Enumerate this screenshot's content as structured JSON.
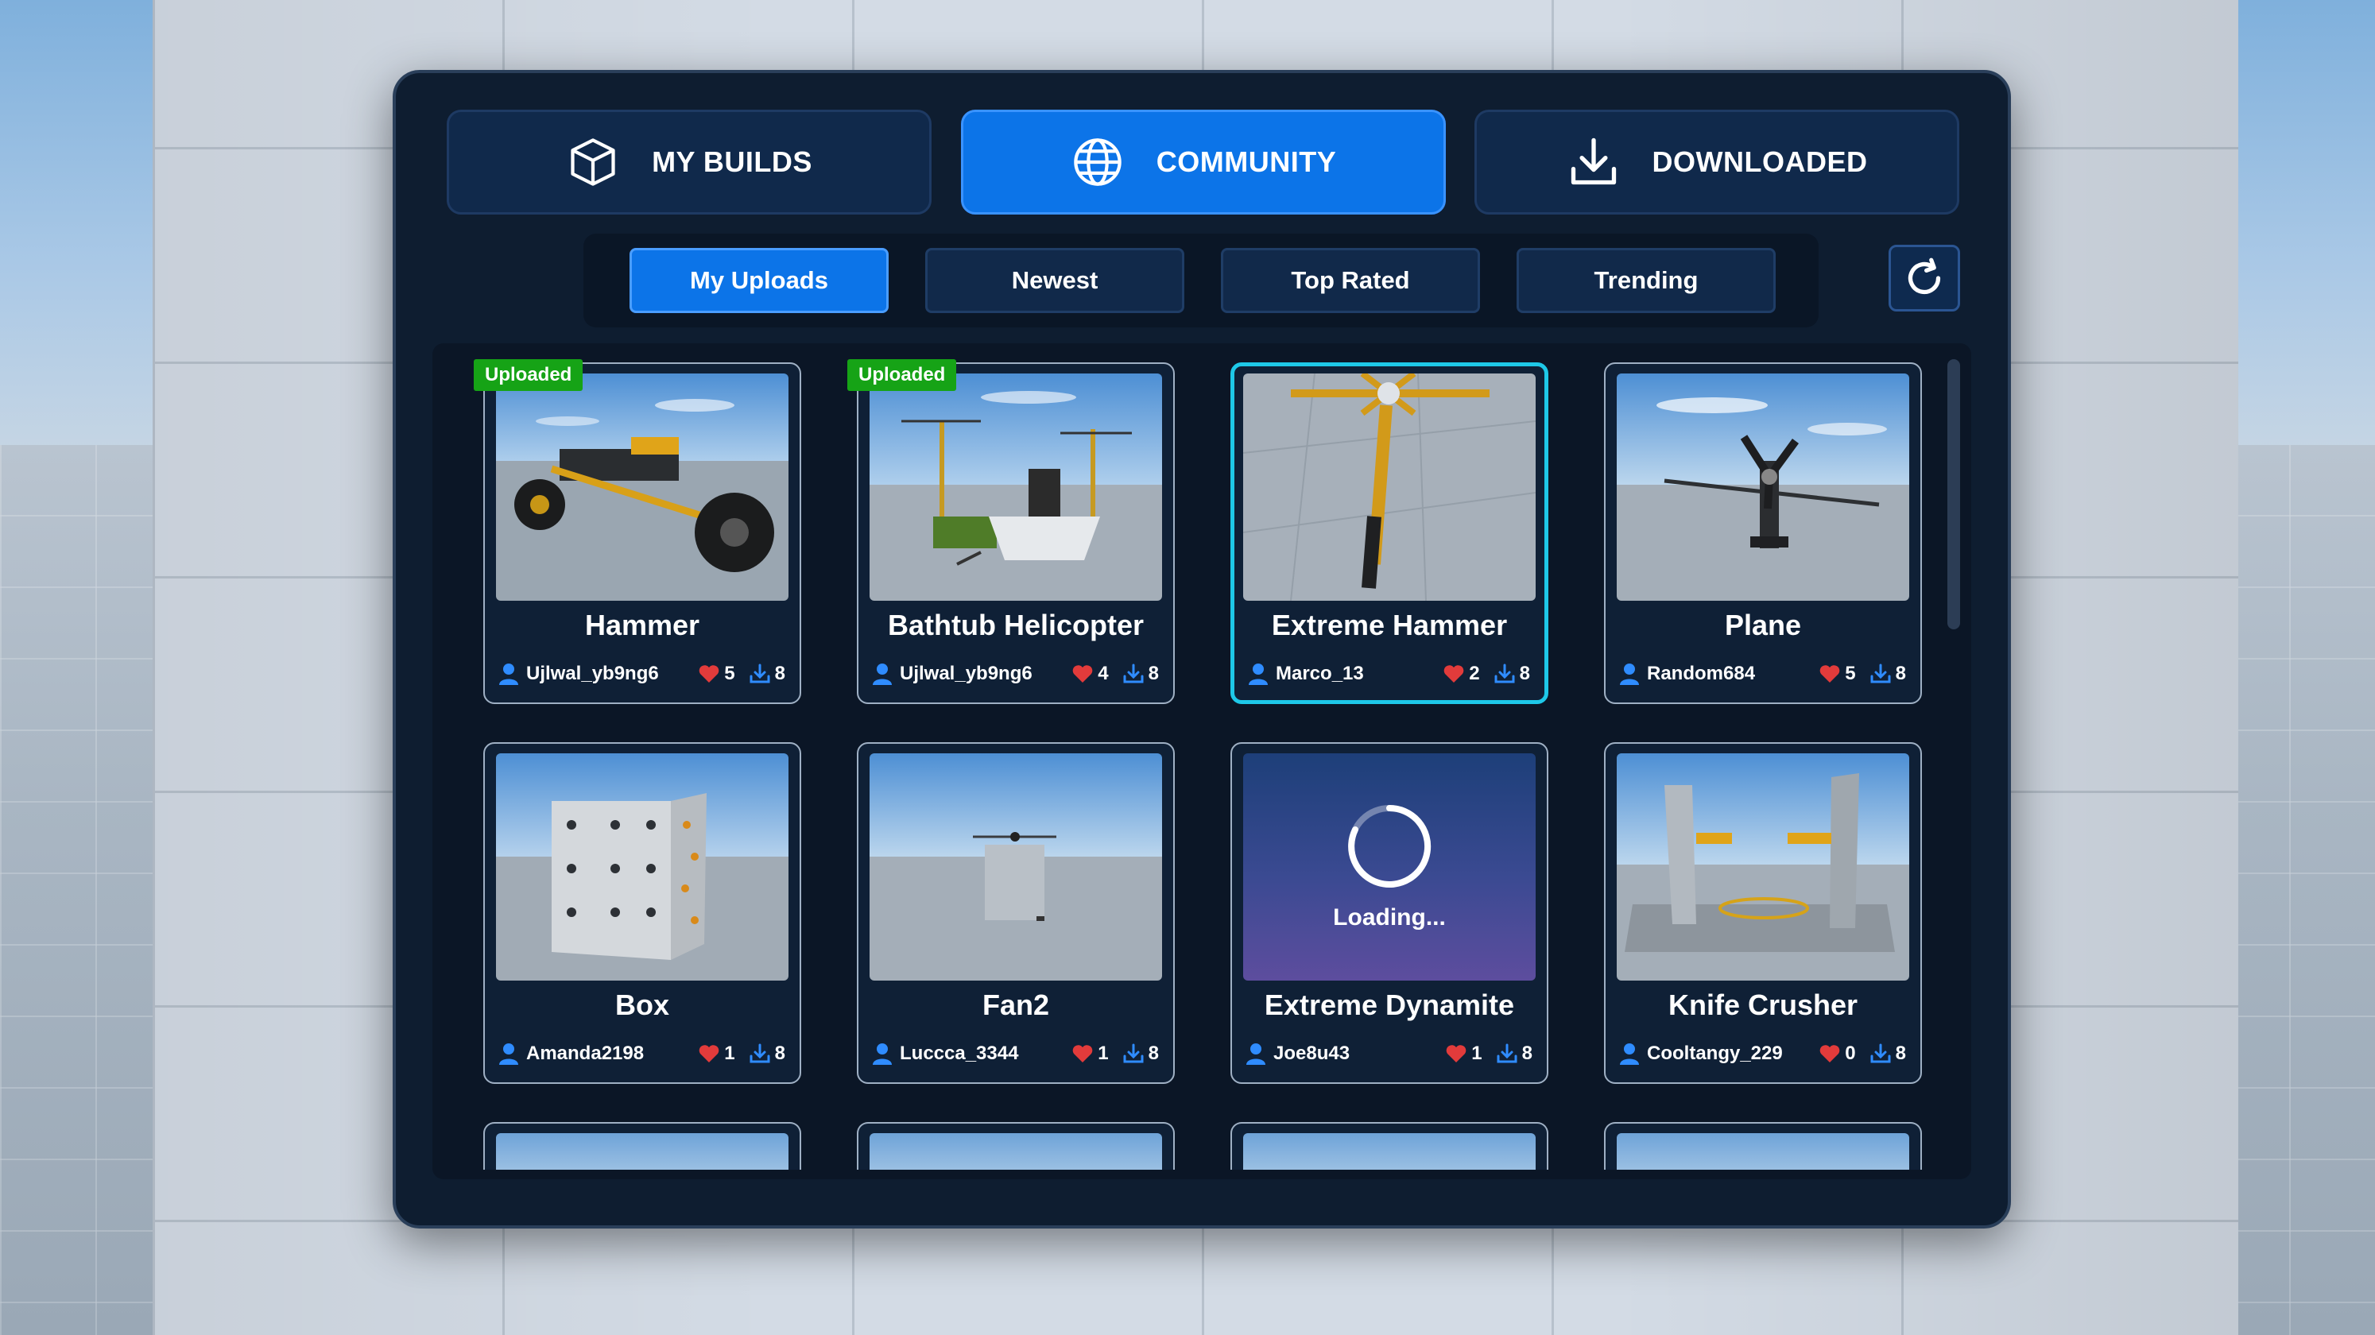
{
  "main_tabs": [
    {
      "label": "MY BUILDS",
      "icon": "cube-icon",
      "active": false
    },
    {
      "label": "COMMUNITY",
      "icon": "globe-icon",
      "active": true
    },
    {
      "label": "DOWNLOADED",
      "icon": "download-icon",
      "active": false
    }
  ],
  "filters": [
    {
      "label": "My Uploads",
      "active": true
    },
    {
      "label": "Newest",
      "active": false
    },
    {
      "label": "Top Rated",
      "active": false
    },
    {
      "label": "Trending",
      "active": false
    }
  ],
  "refresh": {
    "icon": "refresh-icon"
  },
  "builds": [
    {
      "title": "Hammer",
      "author": "Ujlwal_yb9ng6",
      "likes": "5",
      "downloads": "8",
      "badge": "Uploaded"
    },
    {
      "title": "Bathtub Helicopter",
      "author": "Ujlwal_yb9ng6",
      "likes": "4",
      "downloads": "8",
      "badge": "Uploaded"
    },
    {
      "title": "Extreme Hammer",
      "author": "Marco_13",
      "likes": "2",
      "downloads": "8",
      "badge": "",
      "selected": true
    },
    {
      "title": "Plane",
      "author": "Random684",
      "likes": "5",
      "downloads": "8",
      "badge": ""
    },
    {
      "title": "Box",
      "author": "Amanda2198",
      "likes": "1",
      "downloads": "8",
      "badge": ""
    },
    {
      "title": "Fan2",
      "author": "Luccca_3344",
      "likes": "1",
      "downloads": "8",
      "badge": ""
    },
    {
      "title": "Extreme Dynamite",
      "author": "Joe8u43",
      "likes": "1",
      "downloads": "8",
      "badge": "",
      "loading_text": "Loading..."
    },
    {
      "title": "Knife Crusher",
      "author": "Cooltangy_229",
      "likes": "0",
      "downloads": "8",
      "badge": ""
    }
  ],
  "colors": {
    "accent": "#0c74e8",
    "selected_border": "#1ec8e8",
    "badge_green": "#16a316",
    "heart_red": "#e23b3b",
    "icon_blue": "#2f8cff"
  }
}
